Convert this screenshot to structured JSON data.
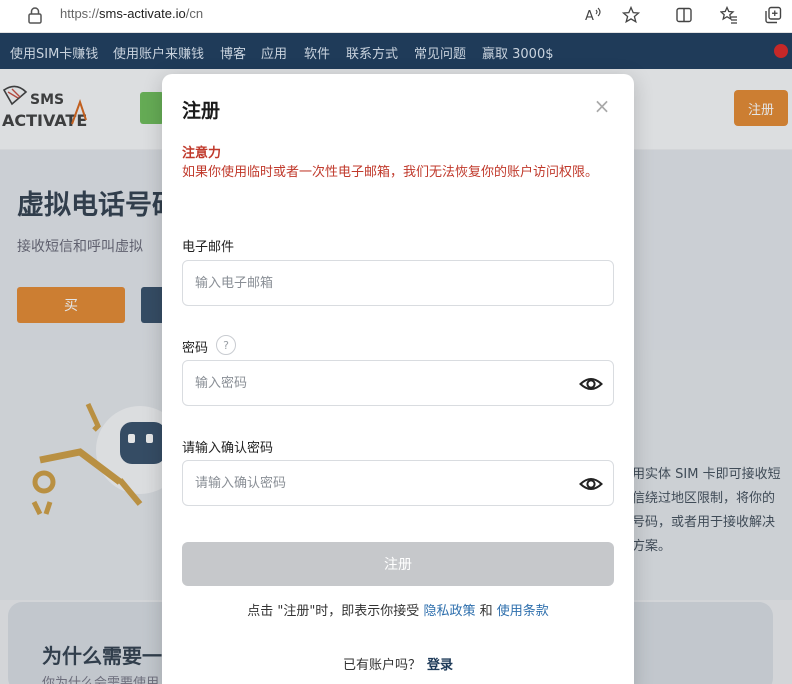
{
  "browser": {
    "url_scheme": "https://",
    "url_host": "sms-activate.io",
    "url_path": "/cn"
  },
  "nav": {
    "items": [
      "使用SIM卡赚钱",
      "使用账户来赚钱",
      "博客",
      "应用",
      "软件",
      "联系方式",
      "常见问题",
      "赢取 3000$"
    ]
  },
  "header": {
    "logo_text_top": "SMS",
    "logo_text_bottom": "ACTIVATE",
    "register_label": "注册"
  },
  "hero": {
    "title": "虚拟电话号码",
    "subtitle": "接收短信和呼叫虚拟",
    "buy_label": "买"
  },
  "features": {
    "text": "用实体 SIM 卡即可接收短信绕过地区限制，将你的号码，或者用于接收解决方案。"
  },
  "why": {
    "title": "为什么需要一",
    "subtitle": "你为什么会需要使用"
  },
  "modal": {
    "title": "注册",
    "close": "×",
    "warning_title": "注意力",
    "warning_text": "如果你使用临时或者一次性电子邮箱，我们无法恢复你的账户访问权限。",
    "email_label": "电子邮件",
    "email_placeholder": "输入电子邮箱",
    "password_label": "密码",
    "password_help": "?",
    "password_placeholder": "输入密码",
    "confirm_label": "请输入确认密码",
    "confirm_placeholder": "请输入确认密码",
    "submit_label": "注册",
    "terms_prefix": "点击 \"注册\"时，即表示你接受",
    "privacy_link": "隐私政策",
    "terms_and": "和",
    "terms_link": "使用条款",
    "login_prompt": "已有账户吗？",
    "login_link": "登录"
  },
  "colors": {
    "nav_bg": "#1f3b59",
    "accent_orange": "#e07b19",
    "warning_red": "#c0392b",
    "link_blue": "#2e6fad",
    "disabled_button": "#c6c8cb"
  }
}
